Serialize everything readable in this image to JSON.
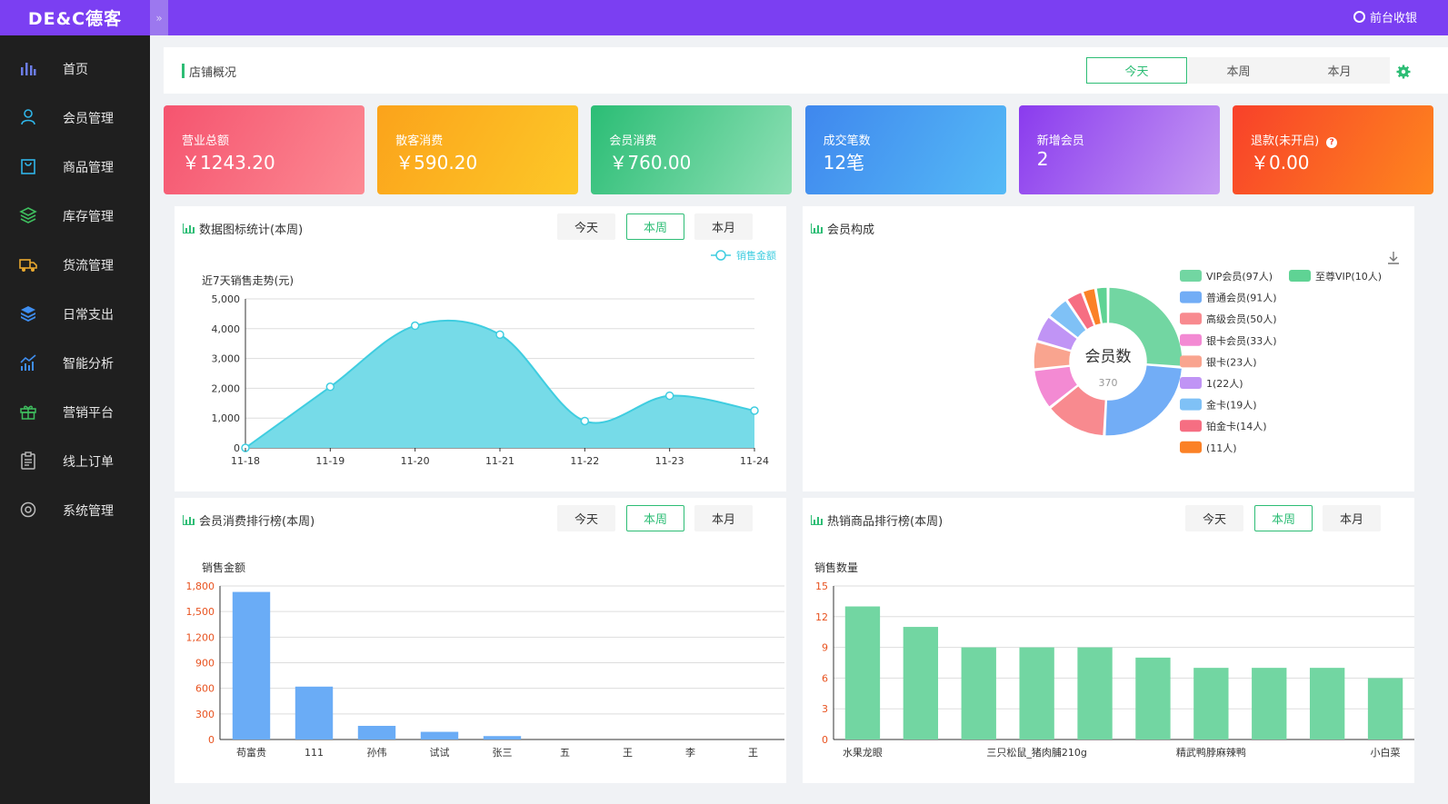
{
  "topbar": {
    "logo": "DE&C德客",
    "collapse_icon": "»",
    "cashier_label": "前台收银"
  },
  "sidebar": {
    "items": [
      {
        "label": "首页",
        "icon": "bar-chart-icon",
        "color": "#6c7de8"
      },
      {
        "label": "会员管理",
        "icon": "user-icon",
        "color": "#2fb5e8"
      },
      {
        "label": "商品管理",
        "icon": "bag-icon",
        "color": "#2fb5e8"
      },
      {
        "label": "库存管理",
        "icon": "layers-icon",
        "color": "#3fbf5f"
      },
      {
        "label": "货流管理",
        "icon": "truck-icon",
        "color": "#e8a82f"
      },
      {
        "label": "日常支出",
        "icon": "stack-icon",
        "color": "#3f8ef0"
      },
      {
        "label": "智能分析",
        "icon": "analysis-icon",
        "color": "#3f8ef0"
      },
      {
        "label": "营销平台",
        "icon": "gift-icon",
        "color": "#3fbf5f"
      },
      {
        "label": "线上订单",
        "icon": "clipboard-icon",
        "color": "#bbbbbb"
      },
      {
        "label": "系统管理",
        "icon": "settings-icon",
        "color": "#bbbbbb"
      }
    ]
  },
  "overview": {
    "title": "店铺概况",
    "tabs": [
      "今天",
      "本周",
      "本月"
    ],
    "active_tab": "今天"
  },
  "stats": [
    {
      "label": "营业总额",
      "value": "￥1243.20",
      "colors": [
        "#f5546f",
        "#fc8a93"
      ]
    },
    {
      "label": "散客消费",
      "value": "￥590.20",
      "colors": [
        "#fba31b",
        "#fdc828"
      ]
    },
    {
      "label": "会员消费",
      "value": "￥760.00",
      "colors": [
        "#2bbd75",
        "#8ee0b5"
      ]
    },
    {
      "label": "成交笔数",
      "value": "12笔",
      "colors": [
        "#3f87ee",
        "#55baf6"
      ]
    },
    {
      "label": "新增会员",
      "value": "2",
      "colors": [
        "#8a3bee",
        "#c69af3"
      ]
    },
    {
      "label": "退款(未开启)",
      "value": "￥0.00",
      "colors": [
        "#f8412a",
        "#fe861e"
      ],
      "help_icon": "?"
    }
  ],
  "panels": {
    "sales_trend": {
      "title": "数据图标统计(本周)",
      "tabs": [
        "今天",
        "本周",
        "本月"
      ],
      "active_tab": "本周"
    },
    "member_composition": {
      "title": "会员构成",
      "download_icon": "download-icon"
    },
    "member_ranking": {
      "title": "会员消费排行榜(本周)",
      "tabs": [
        "今天",
        "本周",
        "本月"
      ],
      "active_tab": "本周"
    },
    "hot_products": {
      "title": "热销商品排行榜(本周)",
      "tabs": [
        "今天",
        "本周",
        "本月"
      ],
      "active_tab": "本周"
    }
  },
  "chart_data": [
    {
      "type": "area",
      "title": "近7天销售走势(元)",
      "x": [
        "11-18",
        "11-19",
        "11-20",
        "11-21",
        "11-22",
        "11-23",
        "11-24"
      ],
      "series": [
        {
          "name": "销售金额",
          "values": [
            0,
            2050,
            4100,
            3800,
            900,
            1750,
            1250
          ],
          "color": "#3fcde0"
        }
      ],
      "ylim": [
        0,
        5000
      ],
      "yticks": [
        "0",
        "1,000",
        "2,000",
        "3,000",
        "4,000",
        "5,000"
      ],
      "grid": true,
      "legend": "top-right"
    },
    {
      "type": "pie",
      "center_label": "会员数",
      "center_value": "370",
      "slices": [
        {
          "label": "VIP会员(97人)",
          "value": 97,
          "color": "#72d6a2"
        },
        {
          "label": "普通会员(91人)",
          "value": 91,
          "color": "#72adf6"
        },
        {
          "label": "高级会员(50人)",
          "value": 50,
          "color": "#f88a8f"
        },
        {
          "label": "银卡会员(33人)",
          "value": 33,
          "color": "#f38ad3"
        },
        {
          "label": "银卡(23人)",
          "value": 23,
          "color": "#f9a48f"
        },
        {
          "label": "1(22人)",
          "value": 22,
          "color": "#c094f5"
        },
        {
          "label": "金卡(19人)",
          "value": 19,
          "color": "#7fc1f6"
        },
        {
          "label": "铂金卡(14人)",
          "value": 14,
          "color": "#f66e82"
        },
        {
          "label": "(11人)",
          "value": 11,
          "color": "#fb8126"
        },
        {
          "label": "至尊VIP(10人)",
          "value": 10,
          "color": "#5fd394"
        }
      ],
      "legend": "right"
    },
    {
      "type": "bar",
      "ylabel": "销售金额",
      "categories": [
        "苟富贵",
        "111",
        "孙伟",
        "试试",
        "张三",
        "五",
        "王",
        "李",
        "王"
      ],
      "values": [
        1730,
        620,
        160,
        90,
        40,
        0,
        0,
        0,
        0
      ],
      "ylim": [
        0,
        1800
      ],
      "yticks": [
        "0",
        "300",
        "600",
        "900",
        "1,200",
        "1,500",
        "1,800"
      ],
      "color": "#6aacf6",
      "grid": true
    },
    {
      "type": "bar",
      "ylabel": "销售数量",
      "categories": [
        "水果龙眼",
        "",
        "",
        "三只松鼠_猪肉脯210g",
        "",
        "",
        "精武鸭脖麻辣鸭",
        "",
        "",
        "小白菜"
      ],
      "values": [
        13,
        11,
        9,
        9,
        9,
        8,
        7,
        7,
        7,
        6
      ],
      "ylim": [
        0,
        15
      ],
      "yticks": [
        "0",
        "3",
        "6",
        "9",
        "12",
        "15"
      ],
      "color": "#72d6a2",
      "grid": true
    }
  ]
}
